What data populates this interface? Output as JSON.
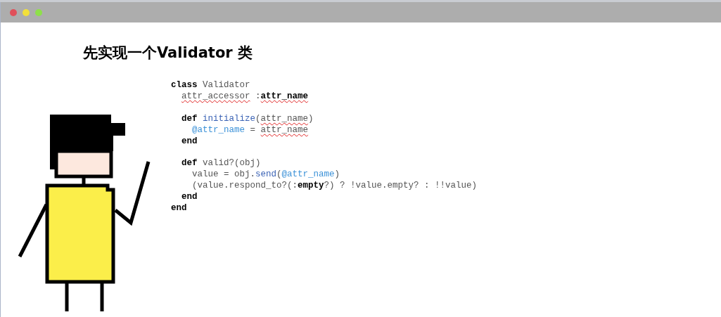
{
  "window": {
    "controls": [
      {
        "color": "#e0505a"
      },
      {
        "color": "#f2e03a"
      },
      {
        "color": "#8ee04a"
      }
    ]
  },
  "slide": {
    "title": "先实现一个Validator 类",
    "figure": {
      "kind": "stick-figure"
    },
    "code": [
      {
        "kind": "code",
        "segments": [
          {
            "text": "class",
            "kind": "keyword"
          },
          {
            "text": " Validator",
            "kind": "plain"
          }
        ]
      },
      {
        "kind": "code",
        "segments": [
          {
            "text": "  attr_accessor",
            "kind": "plain",
            "misspelled": true
          },
          {
            "text": " :",
            "kind": "plain"
          },
          {
            "text": "attr_name",
            "kind": "keyword",
            "misspelled": true
          }
        ]
      },
      {
        "kind": "blank"
      },
      {
        "kind": "code",
        "segments": [
          {
            "text": "  def",
            "kind": "keyword"
          },
          {
            "text": " initialize",
            "kind": "method"
          },
          {
            "text": "(",
            "kind": "plain"
          },
          {
            "text": "attr_name",
            "kind": "plain",
            "misspelled": true
          },
          {
            "text": ")",
            "kind": "plain"
          }
        ]
      },
      {
        "kind": "code",
        "segments": [
          {
            "text": "    @attr_name",
            "kind": "ivar"
          },
          {
            "text": " = ",
            "kind": "plain"
          },
          {
            "text": "attr_name",
            "kind": "plain",
            "misspelled": true
          }
        ]
      },
      {
        "kind": "code",
        "segments": [
          {
            "text": "  end",
            "kind": "keyword"
          }
        ]
      },
      {
        "kind": "blank"
      },
      {
        "kind": "code",
        "segments": [
          {
            "text": "  def",
            "kind": "keyword"
          },
          {
            "text": " valid?(obj)",
            "kind": "plain"
          }
        ]
      },
      {
        "kind": "code",
        "segments": [
          {
            "text": "    value = obj.",
            "kind": "plain"
          },
          {
            "text": "send",
            "kind": "method"
          },
          {
            "text": "(",
            "kind": "plain"
          },
          {
            "text": "@attr_name",
            "kind": "ivar"
          },
          {
            "text": ")",
            "kind": "plain"
          }
        ]
      },
      {
        "kind": "code",
        "segments": [
          {
            "text": "    (value.respond_to?(:",
            "kind": "plain"
          },
          {
            "text": "empty",
            "kind": "keyword"
          },
          {
            "text": "?) ? !value.empty? : !!value)",
            "kind": "plain"
          }
        ]
      },
      {
        "kind": "code",
        "segments": [
          {
            "text": "  end",
            "kind": "keyword"
          }
        ]
      },
      {
        "kind": "code",
        "segments": [
          {
            "text": "end",
            "kind": "keyword"
          }
        ]
      }
    ]
  }
}
